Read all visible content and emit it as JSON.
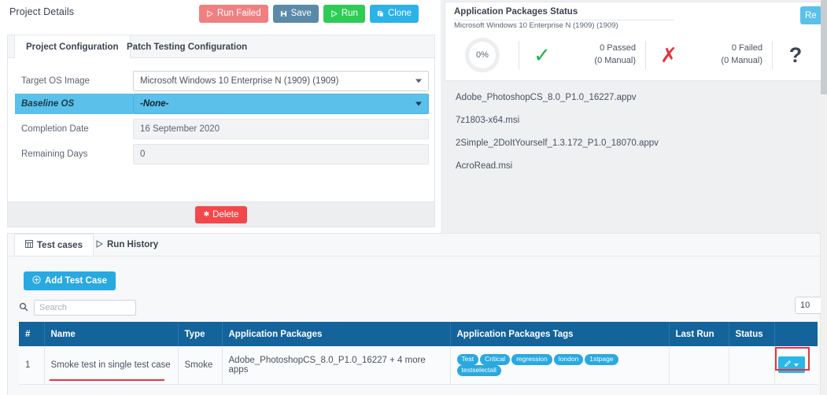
{
  "header": {
    "title": "Project Details",
    "buttons": [
      {
        "label": "Run Failed",
        "icon": "play-icon",
        "color": "#f08080"
      },
      {
        "label": "Save",
        "icon": "floppy-disk-icon",
        "color": "#5b8aa8"
      },
      {
        "label": "Run",
        "icon": "play-icon",
        "color": "#2ecc55"
      },
      {
        "label": "Clone",
        "icon": "copy-icon",
        "color": "#2bb3e8"
      }
    ]
  },
  "config_panel": {
    "tabs": [
      {
        "label": "Project Configuration",
        "active": true
      },
      {
        "label": "Patch Testing Configuration",
        "active": false
      }
    ],
    "fields": [
      {
        "label": "Target OS Image",
        "value": "Microsoft Windows 10 Enterprise N (1909) (1909)",
        "type": "select",
        "highlighted": false
      },
      {
        "label": "Baseline OS",
        "value": "-None-",
        "type": "select",
        "highlighted": true
      },
      {
        "label": "Completion Date",
        "value": "16 September 2020",
        "type": "readonly",
        "highlighted": false
      },
      {
        "label": "Remaining Days",
        "value": "0",
        "type": "readonly",
        "highlighted": false
      }
    ],
    "delete_label": "Delete",
    "delete_icon": "asterisk-icon"
  },
  "status_panel": {
    "title": "Application Packages Status",
    "subtitle": "Microsoft Windows 10 Enterprise N (1909) (1909)",
    "progress": "0%",
    "passed_count": "0 Passed",
    "passed_manual": "(0 Manual)",
    "failed_count": "0 Failed",
    "failed_manual": "(0 Manual)",
    "check_icon": "check-icon",
    "cross_icon": "cross-icon",
    "question_icon": "question-mark-icon",
    "refresh_button_label": "Re"
  },
  "packages": [
    "Adobe_PhotoshopCS_8.0_P1.0_16227.appv",
    "7z1803-x64.msi",
    "2Simple_2DoItYourself_1.3.172_P1.0_18070.appv",
    "AcroRead.msi"
  ],
  "test_cases": {
    "tabs": [
      {
        "label": "Test cases",
        "icon": "table-icon",
        "active": true
      },
      {
        "label": "Run History",
        "icon": "play-icon",
        "active": false
      }
    ],
    "add_button_label": "Add  Test  Case",
    "add_button_icon": "plus-circle-icon",
    "search_placeholder": "Search",
    "search_value": "",
    "search_icon": "search-icon",
    "page_size": "10",
    "columns": [
      "#",
      "Name",
      "Type",
      "Application Packages",
      "Application Packages Tags",
      "Last Run",
      "Status",
      ""
    ],
    "rows": [
      {
        "index": "1",
        "name": "Smoke test in single test case",
        "type": "Smoke",
        "packages": "Adobe_PhotoshopCS_8.0_P1.0_16227 + 4 more apps",
        "tags": [
          "Test",
          "Critical",
          "regression",
          "london",
          "1stpage",
          "testselectall"
        ],
        "last_run": "",
        "status": "",
        "edit_icon": "pencil-icon"
      }
    ]
  },
  "colors": {
    "table_header": "#14639b",
    "accent_blue": "#29a9e0",
    "highlight_blue": "#5bc0ea",
    "danger_red": "#f2484b",
    "annotation_red": "#e8323c",
    "success_green": "#22b24c"
  }
}
